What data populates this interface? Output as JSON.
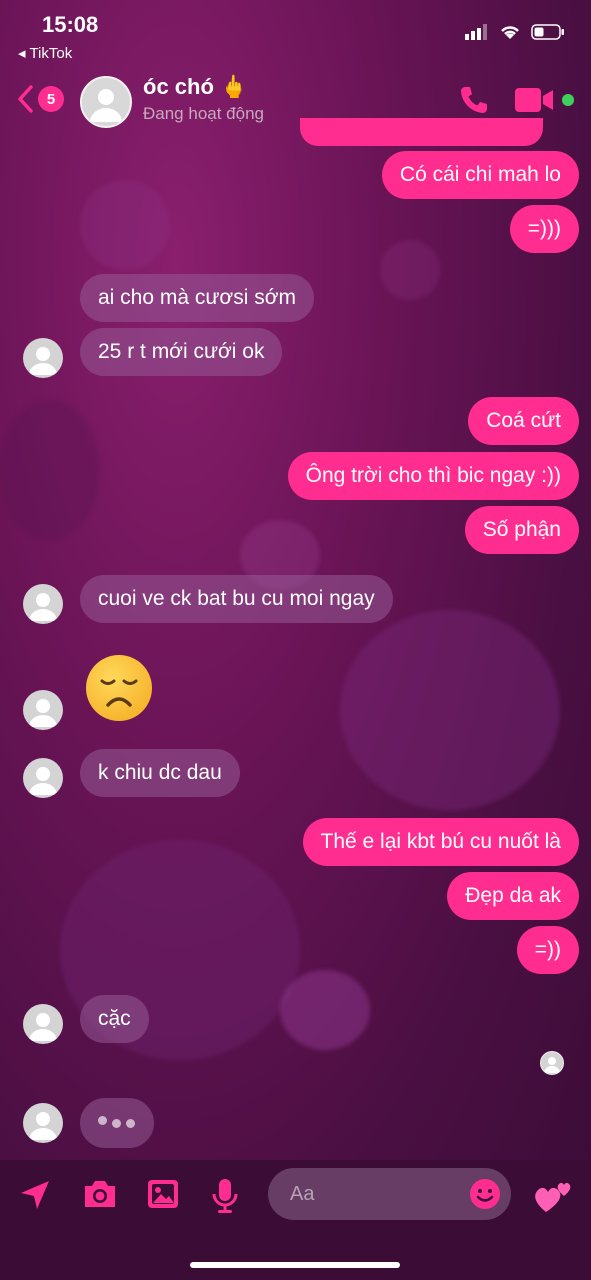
{
  "status_bar": {
    "time": "15:08",
    "back_app": "TikTok"
  },
  "header": {
    "unread_count": "5",
    "name": "óc chó 🖕",
    "status": "Đang hoạt động"
  },
  "messages": [
    {
      "side": "out",
      "text": "Có cái chi mah lo"
    },
    {
      "side": "out",
      "text": "=)))"
    },
    {
      "side": "in",
      "text": "ai cho mà cươsi sớm"
    },
    {
      "side": "in",
      "text": "25 r t mới cưới ok"
    },
    {
      "side": "out",
      "text": "Coá cứt"
    },
    {
      "side": "out",
      "text": "Ông trời cho thì bic ngay :))"
    },
    {
      "side": "out",
      "text": "Số phận"
    },
    {
      "side": "in",
      "text": "cuoi ve ck bat bu cu moi ngay"
    },
    {
      "side": "in",
      "text": "k chiu dc dau"
    },
    {
      "side": "out",
      "text": "Thế e lại kbt bú cu nuốt là"
    },
    {
      "side": "out",
      "text": "Đẹp da ak"
    },
    {
      "side": "out",
      "text": "=))"
    },
    {
      "side": "in",
      "text": "cặc"
    }
  ],
  "composer": {
    "placeholder": "Aa"
  },
  "colors": {
    "accent": "#ff2d8f",
    "incoming": "#8e4f8c",
    "online": "#3ed05a"
  }
}
